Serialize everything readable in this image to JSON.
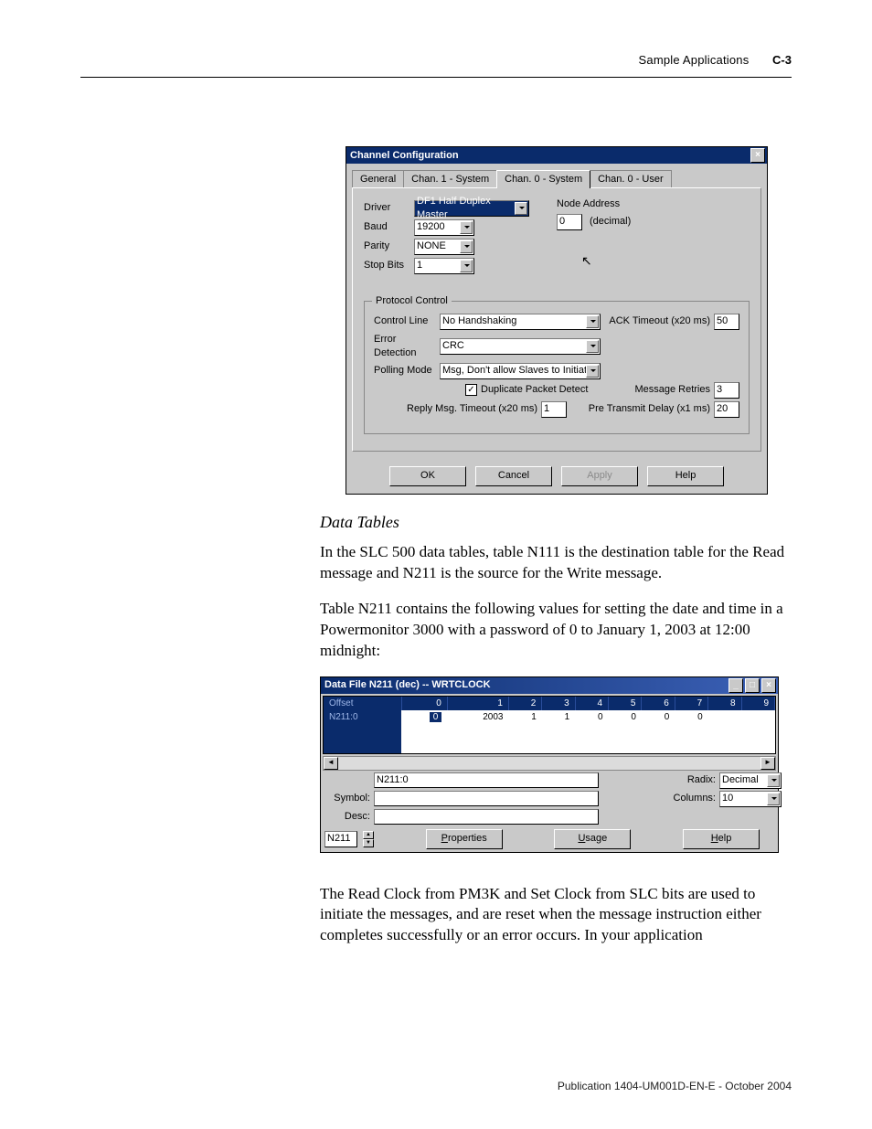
{
  "header": {
    "section": "Sample Applications",
    "page": "C-3"
  },
  "footer": "Publication 1404-UM001D-EN-E - October 2004",
  "dialog": {
    "title": "Channel Configuration",
    "tabs": [
      "General",
      "Chan. 1 - System",
      "Chan. 0 - System",
      "Chan. 0 - User"
    ],
    "active_tab": 2,
    "fields": {
      "driver_label": "Driver",
      "driver_value": "DF1 Half Duplex Master",
      "baud_label": "Baud",
      "baud_value": "19200",
      "parity_label": "Parity",
      "parity_value": "NONE",
      "stopbits_label": "Stop Bits",
      "stopbits_value": "1",
      "node_addr_label": "Node Address",
      "node_addr_value": "0",
      "node_addr_unit": "(decimal)"
    },
    "protocol": {
      "group_title": "Protocol Control",
      "control_line_label": "Control Line",
      "control_line_value": "No Handshaking",
      "error_det_label": "Error Detection",
      "error_det_value": "CRC",
      "polling_label": "Polling Mode",
      "polling_value": "Msg, Don't allow Slaves to Initiat",
      "dup_label": "Duplicate Packet Detect",
      "dup_checked": true,
      "ack_label": "ACK Timeout (x20 ms)",
      "ack_value": "50",
      "reply_label": "Reply Msg. Timeout (x20 ms)",
      "reply_value": "1",
      "retries_label": "Message Retries",
      "retries_value": "3",
      "pretx_label": "Pre Transmit Delay (x1 ms)",
      "pretx_value": "20"
    },
    "buttons": {
      "ok": "OK",
      "cancel": "Cancel",
      "apply": "Apply",
      "help": "Help"
    }
  },
  "text": {
    "data_tables_heading": "Data Tables",
    "para1": "In the SLC 500 data tables, table N111 is the destination table for the Read message and N211 is the source for the Write message.",
    "para2": "Table N211 contains the following values for setting the date and time in a Powermonitor 3000 with a password of 0 to January 1, 2003 at 12:00 midnight:",
    "para3": "The Read Clock from PM3K and Set Clock from SLC bits are used to initiate the messages, and are reset when the message instruction either completes successfully or an error occurs. In your application"
  },
  "datafile": {
    "title": "Data File N211 (dec)  --  WRTCLOCK",
    "offset_label": "Offset",
    "columns": [
      "0",
      "1",
      "2",
      "3",
      "4",
      "5",
      "6",
      "7",
      "8",
      "9"
    ],
    "row_label": "N211:0",
    "row": [
      "0",
      "2003",
      "1",
      "1",
      "0",
      "0",
      "0",
      "0",
      "",
      ""
    ],
    "address_value": "N211:0",
    "radix_label": "Radix:",
    "radix_value": "Decimal",
    "symbol_label": "Symbol:",
    "symbol_value": "",
    "columns_label": "Columns:",
    "columns_value": "10",
    "desc_label": "Desc:",
    "desc_value": "",
    "file_nav": "N211",
    "buttons": {
      "properties": "Properties",
      "usage": "Usage",
      "help": "Help"
    }
  }
}
